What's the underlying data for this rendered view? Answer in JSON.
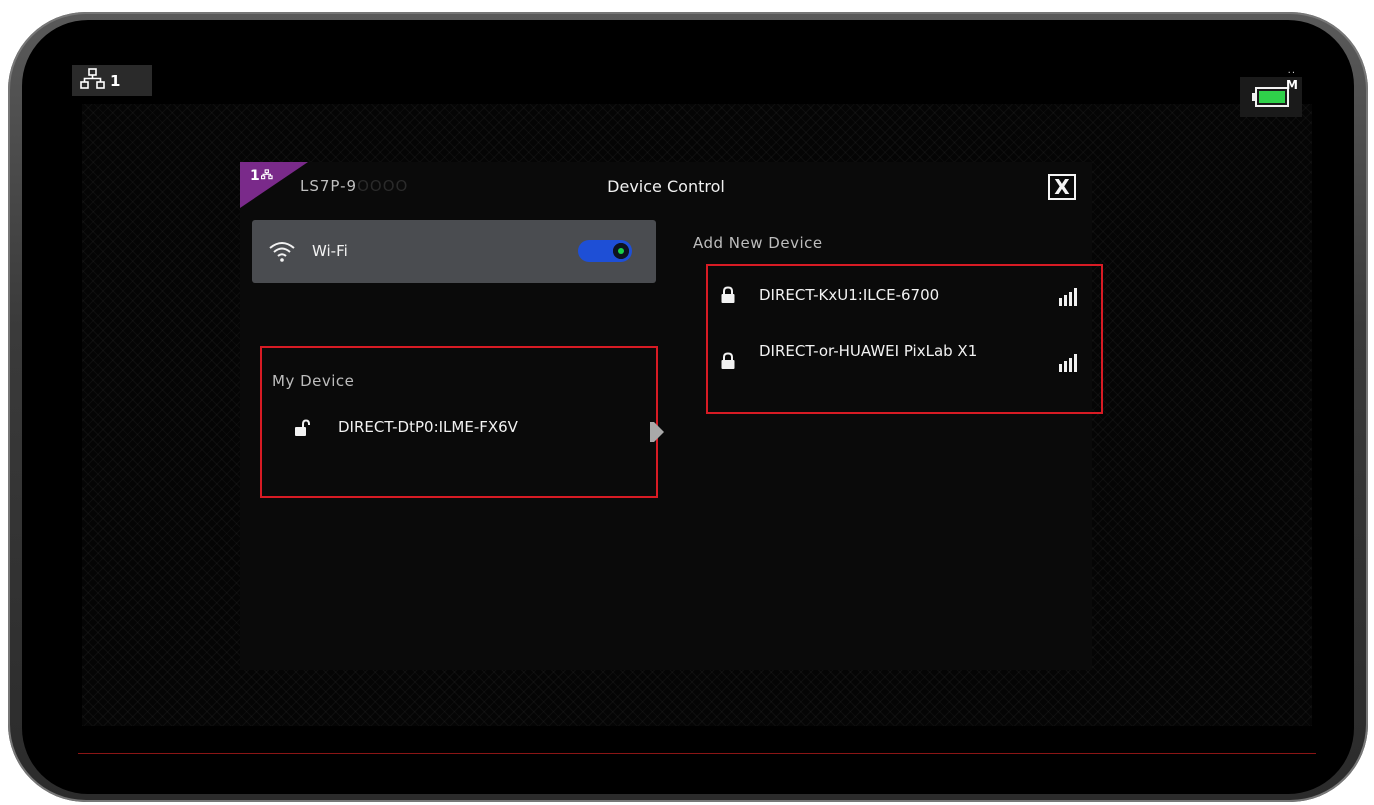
{
  "status_bar": {
    "network_icon": "network-tree-icon",
    "network_count": "1",
    "battery_mode": "M",
    "battery_dots": "··",
    "battery_color": "#2fd14a"
  },
  "panel": {
    "badge_number": "1",
    "badge_icon": "network-tree-icon",
    "badge_color": "#7a2a8a",
    "host_name": "LS7P-9",
    "host_suffix": "OOOO",
    "title": "Device Control",
    "close_label": "X"
  },
  "wifi": {
    "label": "Wi-Fi",
    "icon": "wifi-icon",
    "enabled": true,
    "toggle_color": "#1e4fd6"
  },
  "my_device": {
    "title": "My Device",
    "items": [
      {
        "name": "DIRECT-DtP0:ILME-FX6V",
        "icon": "unlocked-icon",
        "action_icon": "play-arrow-icon"
      }
    ]
  },
  "add_new_device": {
    "title": "Add New Device",
    "items": [
      {
        "name": "DIRECT-KxU1:ILCE-6700",
        "icon": "lock-icon",
        "signal": "signal-full-icon"
      },
      {
        "name": "DIRECT-or-HUAWEI PixLab X1",
        "icon": "lock-icon",
        "signal": "signal-full-icon"
      }
    ]
  },
  "colors": {
    "highlight": "#d81b24",
    "accent_line": "#8a1515"
  }
}
